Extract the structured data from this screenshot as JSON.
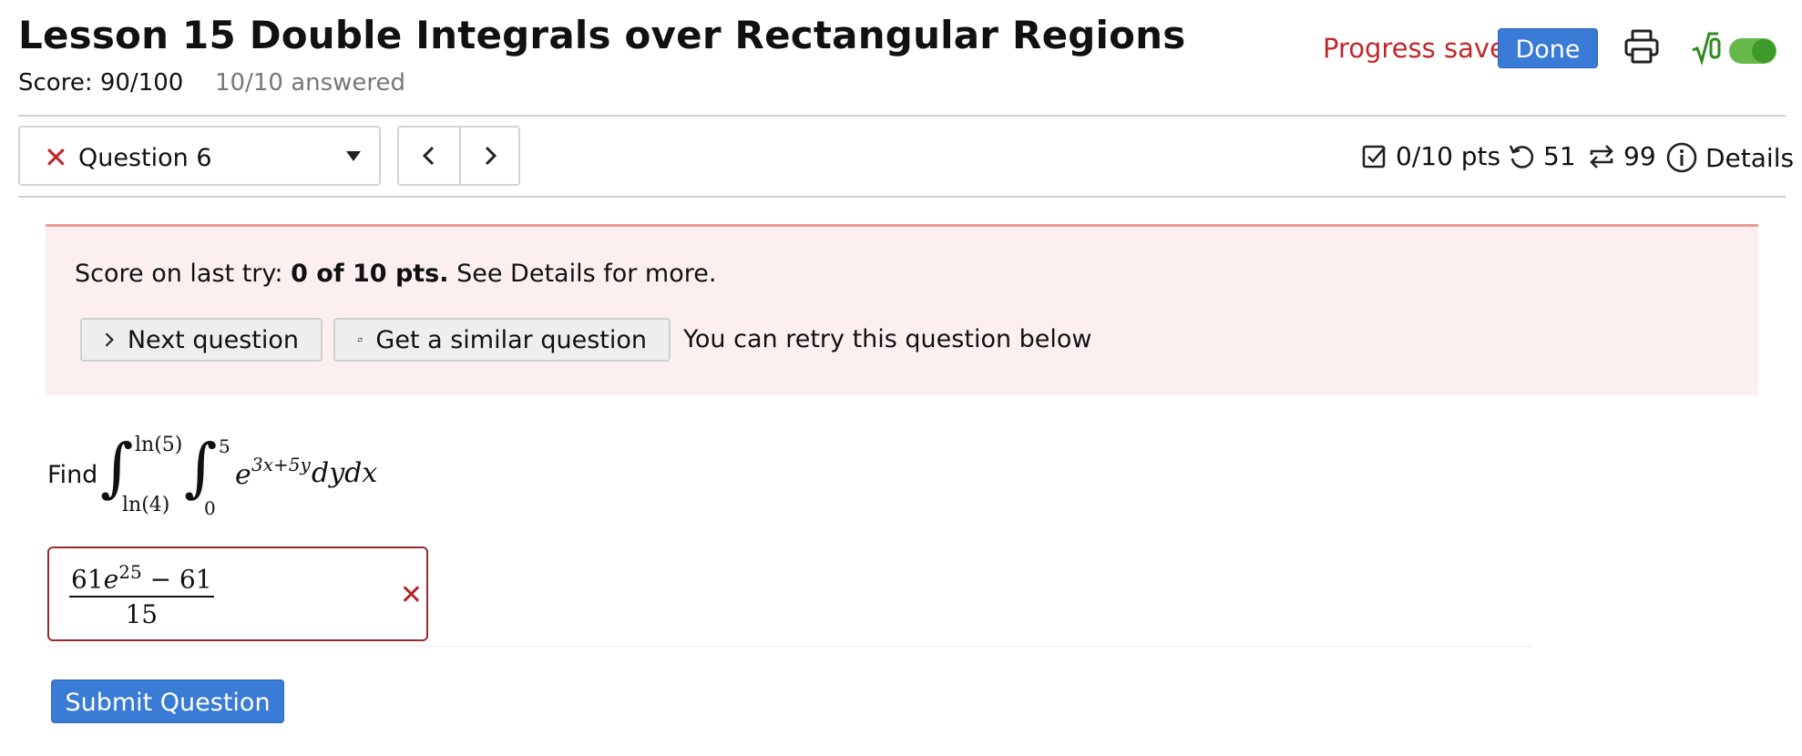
{
  "header": {
    "title": "Lesson 15 Double Integrals over Rectangular Regions",
    "score": "Score: 90/100",
    "answered": "10/10 answered",
    "progress_saved": "Progress saved",
    "done_label": "Done",
    "print_icon": "printer-icon",
    "math_toggle_icon": "sqrt-0-icon"
  },
  "question_bar": {
    "question_label": "Question 6",
    "status_icon": "close-icon",
    "points": "0/10 pts",
    "attempts": "51",
    "similar": "99",
    "details_label": "Details"
  },
  "feedback": {
    "score_prefix": "Score on last try: ",
    "score_bold": "0 of 10 pts.",
    "score_suffix": " See Details for more.",
    "next_label": "Next question",
    "similar_label": "Get a similar question",
    "retry_text": "You can retry this question below"
  },
  "question": {
    "prefix": "Find",
    "outer_upper": "ln(5)",
    "outer_lower": "ln(4)",
    "inner_upper": "5",
    "inner_lower": "0",
    "integrand_base": "e",
    "integrand_exp": "3x+5y",
    "differentials": "dydx"
  },
  "answer": {
    "numerator_coef": "61",
    "numerator_base": "e",
    "numerator_exp": "25",
    "numerator_rest": " − 61",
    "denominator": "15"
  },
  "submit_label": "Submit Question",
  "colors": {
    "accent_blue": "#3a7bd5",
    "error_red": "#c0282b",
    "feedback_bg": "#fbf0ef",
    "toggle_green": "#66b84a"
  }
}
